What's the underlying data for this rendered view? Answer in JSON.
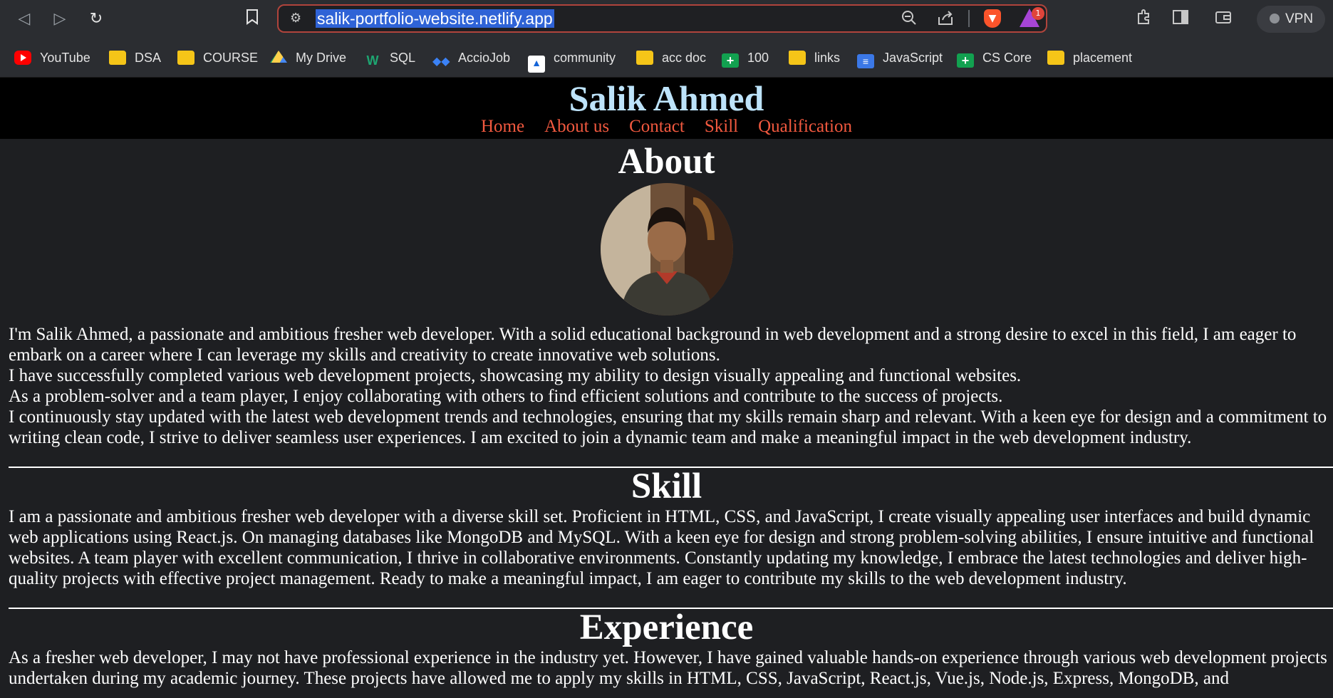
{
  "browser": {
    "url": "salik-portfolio-website.netlify.app",
    "vpn_label": "VPN",
    "rewards_badge": "1",
    "bookmarks": [
      {
        "label": "YouTube",
        "icon": "youtube-icon"
      },
      {
        "label": "DSA",
        "icon": "folder-icon"
      },
      {
        "label": "COURSE",
        "icon": "folder-icon"
      },
      {
        "label": "My Drive",
        "icon": "google-drive-icon"
      },
      {
        "label": "SQL",
        "icon": "w-icon"
      },
      {
        "label": "AccioJob",
        "icon": "acciojob-icon"
      },
      {
        "label": "community",
        "icon": "community-icon"
      },
      {
        "label": "acc doc",
        "icon": "folder-icon"
      },
      {
        "label": "100",
        "icon": "sheets-icon"
      },
      {
        "label": "links",
        "icon": "folder-icon"
      },
      {
        "label": "JavaScript",
        "icon": "docs-icon"
      },
      {
        "label": "CS Core",
        "icon": "sheets-icon"
      },
      {
        "label": "placement",
        "icon": "folder-icon"
      }
    ]
  },
  "site": {
    "title": "Salik Ahmed",
    "nav": [
      "Home",
      "About us",
      "Contact",
      "Skill",
      "Qualification"
    ],
    "colors": {
      "title": "#bde3fa",
      "nav": "#f2593f",
      "header_bg": "#000000",
      "page_bg": "#1e1f22"
    },
    "about": {
      "heading": "About",
      "lines": [
        "I'm Salik Ahmed, a passionate and ambitious fresher web developer. With a solid educational background in web development and a strong desire to excel in this field, I am eager to embark on a career where I can leverage my skills and creativity to create innovative web solutions.",
        "I have successfully completed various web development projects, showcasing my ability to design visually appealing and functional websites.",
        "As a problem-solver and a team player, I enjoy collaborating with others to find efficient solutions and contribute to the success of projects.",
        "I continuously stay updated with the latest web development trends and technologies, ensuring that my skills remain sharp and relevant. With a keen eye for design and a commitment to writing clean code, I strive to deliver seamless user experiences. I am excited to join a dynamic team and make a meaningful impact in the web development industry."
      ]
    },
    "skill": {
      "heading": "Skill",
      "text": "I am a passionate and ambitious fresher web developer with a diverse skill set. Proficient in HTML, CSS, and JavaScript, I create visually appealing user interfaces and build dynamic web applications using React.js. On managing databases like MongoDB and MySQL. With a keen eye for design and strong problem-solving abilities, I ensure intuitive and functional websites. A team player with excellent communication, I thrive in collaborative environments. Constantly updating my knowledge, I embrace the latest technologies and deliver high-quality projects with effective project management. Ready to make a meaningful impact, I am eager to contribute my skills to the web development industry."
    },
    "experience": {
      "heading": "Experience",
      "text": "As a fresher web developer, I may not have professional experience in the industry yet. However, I have gained valuable hands-on experience through various web development projects undertaken during my academic journey. These projects have allowed me to apply my skills in HTML, CSS, JavaScript, React.js, Vue.js, Node.js, Express, MongoDB, and"
    }
  }
}
